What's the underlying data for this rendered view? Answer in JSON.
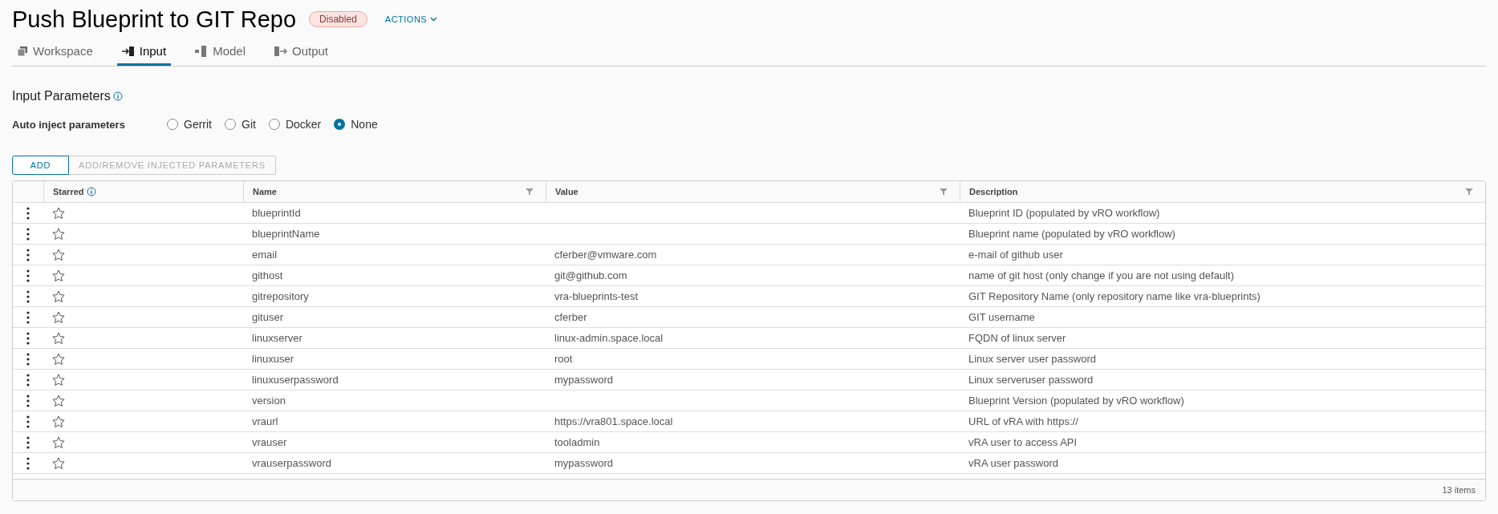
{
  "header": {
    "title": "Push Blueprint to GIT Repo",
    "status": "Disabled",
    "actions": "ACTIONS"
  },
  "tabs": [
    {
      "label": "Workspace",
      "selected": false,
      "kind": "workspace"
    },
    {
      "label": "Input",
      "selected": true,
      "kind": "input"
    },
    {
      "label": "Model",
      "selected": false,
      "kind": "model"
    },
    {
      "label": "Output",
      "selected": false,
      "kind": "output"
    }
  ],
  "section": {
    "title": "Input Parameters",
    "auto_inject_label": "Auto inject parameters",
    "options": [
      {
        "label": "Gerrit",
        "selected": false
      },
      {
        "label": "Git",
        "selected": false
      },
      {
        "label": "Docker",
        "selected": false
      },
      {
        "label": "None",
        "selected": true
      }
    ]
  },
  "buttons": [
    {
      "label": "ADD",
      "disabled": false
    },
    {
      "label": "ADD/REMOVE INJECTED PARAMETERS",
      "disabled": true
    }
  ],
  "table": {
    "columns": [
      "Starred",
      "Name",
      "Value",
      "Description"
    ],
    "rows": [
      {
        "starred": false,
        "name": "blueprintId",
        "value": "",
        "description": "Blueprint ID (populated by vRO workflow)"
      },
      {
        "starred": false,
        "name": "blueprintName",
        "value": "",
        "description": "Blueprint name (populated by vRO workflow)"
      },
      {
        "starred": false,
        "name": "email",
        "value": "cferber@vmware.com",
        "description": "e-mail of github user"
      },
      {
        "starred": false,
        "name": "githost",
        "value": "git@github.com",
        "description": "name of git host (only change if you are not using default)"
      },
      {
        "starred": false,
        "name": "gitrepository",
        "value": "vra-blueprints-test",
        "description": "GIT Repository Name (only repository name like vra-blueprints)"
      },
      {
        "starred": false,
        "name": "gituser",
        "value": "cferber",
        "description": "GIT username"
      },
      {
        "starred": false,
        "name": "linuxserver",
        "value": "linux-admin.space.local",
        "description": "FQDN of linux server"
      },
      {
        "starred": false,
        "name": "linuxuser",
        "value": "root",
        "description": "Linux server user password"
      },
      {
        "starred": false,
        "name": "linuxuserpassword",
        "value": "mypassword",
        "description": "Linux serveruser password"
      },
      {
        "starred": false,
        "name": "version",
        "value": "",
        "description": "Blueprint Version (populated by vRO workflow)"
      },
      {
        "starred": false,
        "name": "vraurl",
        "value": "https://vra801.space.local",
        "description": "URL of vRA with https://"
      },
      {
        "starred": false,
        "name": "vrauser",
        "value": "tooladmin",
        "description": "vRA user to access API"
      },
      {
        "starred": false,
        "name": "vrauserpassword",
        "value": "mypassword",
        "description": "vRA user password"
      }
    ],
    "footer": "13 items"
  }
}
